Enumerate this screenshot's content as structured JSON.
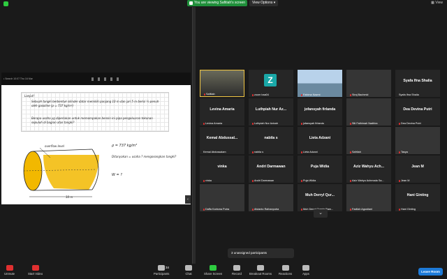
{
  "topbar": {
    "viewing_label": "You are viewing Safitiah's screen",
    "view_options": "View Options",
    "view_button": "View"
  },
  "shared": {
    "status": "• Search  10:07  Thu 16 Mar",
    "note_text_1": "Lanjut!",
    "note_text_2": "Sebuah tangki berbentuk silinder datar memiliki panjang 10 m dan jari 5 m berisi ½ penuh oleh gasoline (ρ = 737 kg/m³)",
    "note_text_3": "Berapa usaha yg diperlukan untuk memompakan bensin ini pipa pengeluaran tekanan sepuluh di bagian atas tangki?",
    "label_overflow": "overflow level",
    "label_rho": "ρ = 737 kg/m³",
    "label_question": "Ditanyakan = usaha ? mengosongkan tangki?",
    "label_w": "W = ?",
    "label_length": "10 m"
  },
  "gallery": [
    {
      "name": "Safitiah",
      "big": "",
      "kind": "photo1",
      "muted": true
    },
    {
      "name": "zoom baa04",
      "big": "",
      "kind": "z",
      "muted": true
    },
    {
      "name": "Fahima Nazmi",
      "big": "",
      "kind": "photo2",
      "muted": true
    },
    {
      "name": "Siraj Bachmid",
      "big": "",
      "kind": "photo3",
      "muted": true
    },
    {
      "name": "Syafa Ifna Shalia",
      "big": "Syafa Ifna Shalia",
      "kind": "",
      "muted": false
    },
    {
      "name": "Levina Amaria",
      "big": "Levina Amaria",
      "kind": "",
      "muted": true
    },
    {
      "name": "Luthpiah Nur Azizah",
      "big": "Luthpiah Nur Az...",
      "kind": "",
      "muted": true
    },
    {
      "name": "jofansyah firlanda",
      "big": "jofansyah firlanda",
      "kind": "",
      "muted": true
    },
    {
      "name": "Siti Fathimah Nadhira",
      "big": "",
      "kind": "photo3",
      "muted": true
    },
    {
      "name": "Dea Devina Putri",
      "big": "Dea Devina Putri",
      "kind": "",
      "muted": true
    },
    {
      "name": "Kemal Abdussalam",
      "big": "Kemal Abdussal...",
      "kind": "",
      "muted": false
    },
    {
      "name": "nabila s",
      "big": "nabila s",
      "kind": "",
      "muted": true
    },
    {
      "name": "Lieta Adzani",
      "big": "Lieta Adzani",
      "kind": "",
      "muted": true
    },
    {
      "name": "Safrilah",
      "big": "",
      "kind": "photo3",
      "muted": true
    },
    {
      "name": "Tasya",
      "big": "",
      "kind": "photo3",
      "muted": true
    },
    {
      "name": "vinka",
      "big": "vinka",
      "kind": "",
      "muted": true
    },
    {
      "name": "Andri Darmawan",
      "big": "Andri Darmawan",
      "kind": "",
      "muted": true
    },
    {
      "name": "Puja Widia",
      "big": "Puja Widia",
      "kind": "",
      "muted": true
    },
    {
      "name": "Aziz Wahyu Achmada Sa...",
      "big": "Aziz Wahyu Ach...",
      "kind": "",
      "muted": true
    },
    {
      "name": "Jean M",
      "big": "Jean M",
      "kind": "",
      "muted": true
    },
    {
      "name": "Daffa Karisma Putra",
      "big": "",
      "kind": "photo3",
      "muted": true
    },
    {
      "name": "Alvianto Raihanputra",
      "big": "",
      "kind": "photo3",
      "muted": true
    },
    {
      "name": "Muh Derryl Qurnia Ram...",
      "big": "Muh Derryl Qur...",
      "kind": "",
      "muted": true
    },
    {
      "name": "Fadilah Agustiani",
      "big": "",
      "kind": "photo3",
      "muted": true
    },
    {
      "name": "Hani Ginting",
      "big": "Hani Ginting",
      "kind": "",
      "muted": true
    }
  ],
  "unassigned": "3 unassigned participants",
  "toolbar": {
    "unmute": "Unmute",
    "start_video": "Start Video",
    "participants": "Participants",
    "participants_count": "34",
    "chat": "Chat",
    "share_screen": "Share Screen",
    "record": "Record",
    "breakout": "Breakout Rooms",
    "reactions": "Reactions",
    "apps": "Apps",
    "leave": "Leave Room"
  },
  "colors": {
    "accent_green": "#2ecc40",
    "leave_blue": "#1e7bd8",
    "mic_red": "#e03030"
  }
}
